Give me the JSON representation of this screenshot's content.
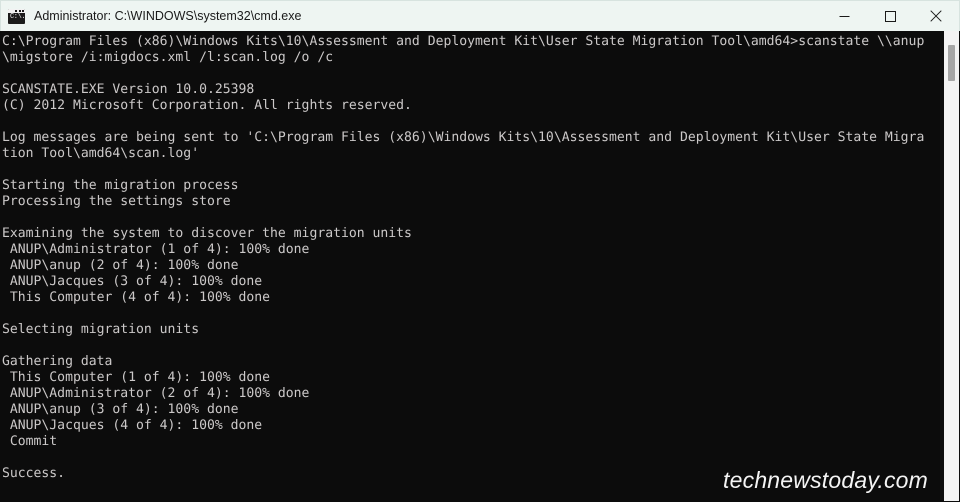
{
  "window": {
    "title": "Administrator: C:\\WINDOWS\\system32\\cmd.exe",
    "icon": "console-icon",
    "icon_text": "C:\\.",
    "background_color": "#0c0c0c",
    "titlebar_color": "#eef5f2",
    "text_color": "#ccc9c9",
    "controls": {
      "minimize_label": "Minimize",
      "maximize_label": "Maximize",
      "close_label": "Close"
    }
  },
  "scrollbar": {
    "track_color": "#f3f3f3",
    "thumb_color": "#a6a6a6"
  },
  "watermark": {
    "text": "technewstoday.com"
  },
  "console": {
    "prompt_path": "C:\\Program Files (x86)\\Windows Kits\\10\\Assessment and Deployment Kit\\User State Migration Tool\\amd64>",
    "command": "scanstate \\\\anup\\migstore /i:migdocs.xml /l:scan.log /o /c",
    "lines": [
      "C:\\Program Files (x86)\\Windows Kits\\10\\Assessment and Deployment Kit\\User State Migration Tool\\amd64>scanstate \\\\anup",
      "\\migstore /i:migdocs.xml /l:scan.log /o /c",
      "",
      "SCANSTATE.EXE Version 10.0.25398",
      "(C) 2012 Microsoft Corporation. All rights reserved.",
      "",
      "Log messages are being sent to 'C:\\Program Files (x86)\\Windows Kits\\10\\Assessment and Deployment Kit\\User State Migra",
      "tion Tool\\amd64\\scan.log'",
      "",
      "Starting the migration process",
      "Processing the settings store",
      "",
      "Examining the system to discover the migration units",
      " ANUP\\Administrator (1 of 4): 100% done",
      " ANUP\\anup (2 of 4): 100% done",
      " ANUP\\Jacques (3 of 4): 100% done",
      " This Computer (4 of 4): 100% done",
      "",
      "Selecting migration units",
      "",
      "Gathering data",
      " This Computer (1 of 4): 100% done",
      " ANUP\\Administrator (2 of 4): 100% done",
      " ANUP\\anup (3 of 4): 100% done",
      " ANUP\\Jacques (4 of 4): 100% done",
      " Commit",
      "",
      "Success."
    ]
  }
}
